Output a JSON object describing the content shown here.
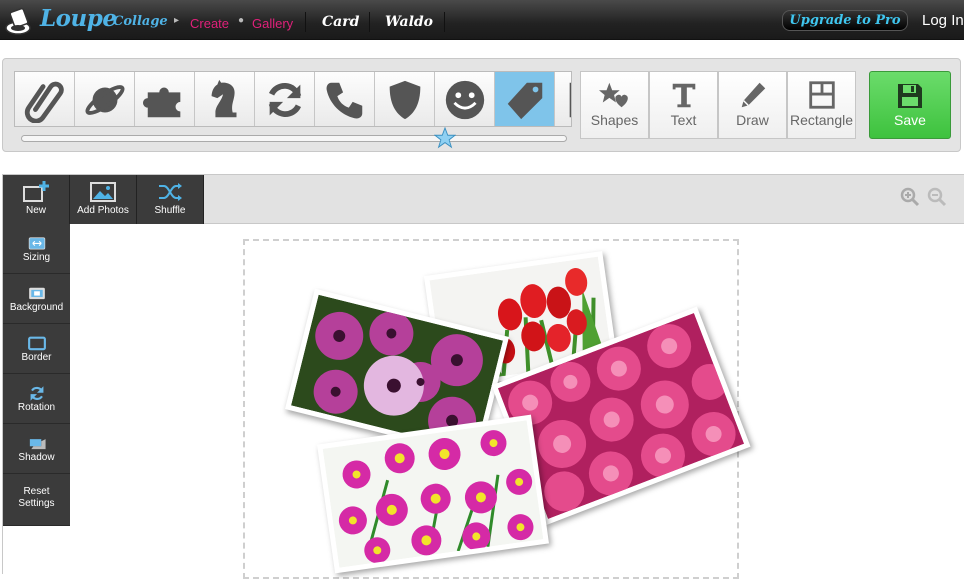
{
  "nav": {
    "brand_main": "Loupe",
    "brand_sub": "Collage",
    "links": [
      {
        "label": "Create"
      },
      {
        "label": "Gallery"
      },
      {
        "label": "Card"
      },
      {
        "label": "Waldo"
      }
    ],
    "upgrade_label": "Upgrade to Pro",
    "login_label": "Log In"
  },
  "toolbar": {
    "categories": [
      "paperclip-icon",
      "planet-icon",
      "puzzle-icon",
      "chess-knight-icon",
      "refresh-icon",
      "phone-icon",
      "shield-icon",
      "smiley-icon",
      "tag-icon",
      "boot-icon"
    ],
    "selected_category": "tag-icon",
    "tools": [
      {
        "label": "Shapes"
      },
      {
        "label": "Text"
      },
      {
        "label": "Draw"
      },
      {
        "label": "Rectangle"
      }
    ],
    "save_label": "Save"
  },
  "editor": {
    "top_buttons": [
      {
        "label": "New"
      },
      {
        "label": "Add Photos"
      },
      {
        "label": "Shuffle"
      }
    ],
    "side_buttons": [
      {
        "label": "Sizing"
      },
      {
        "label": "Background"
      },
      {
        "label": "Border"
      },
      {
        "label": "Rotation"
      },
      {
        "label": "Shadow"
      },
      {
        "label": "Reset Settings"
      }
    ]
  },
  "colors": {
    "accent_blue": "#4fb3e6",
    "nav_pink": "#e0207a",
    "save_green": "#4ccf4c",
    "selected_cat": "#7fc4ea"
  }
}
